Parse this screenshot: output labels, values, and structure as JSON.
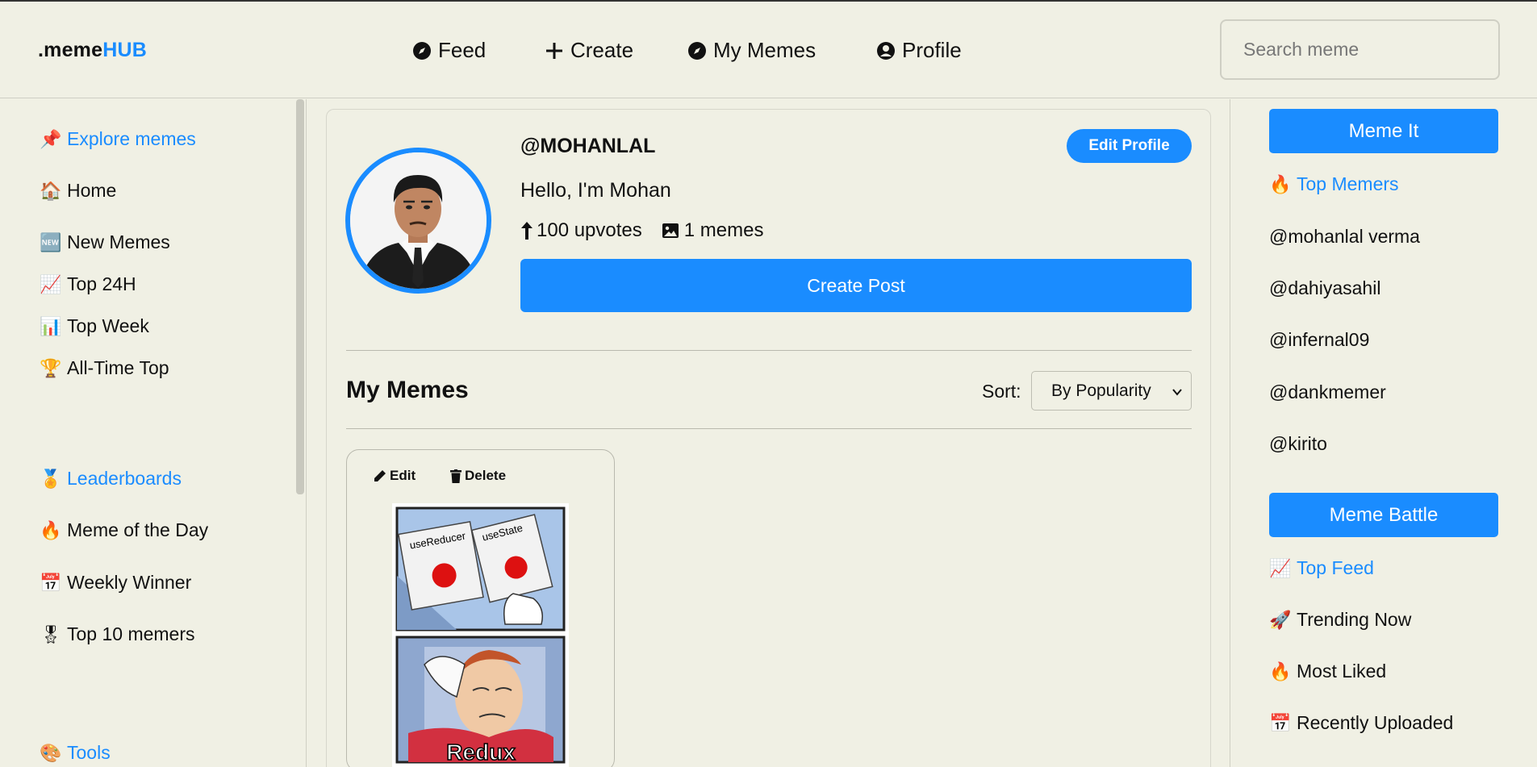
{
  "brand": {
    "prefix": ".meme",
    "suffix": "HUB"
  },
  "nav": [
    {
      "label": "Feed",
      "icon": "compass-icon"
    },
    {
      "label": "Create",
      "icon": "plus-icon"
    },
    {
      "label": "My Memes",
      "icon": "compass-icon"
    },
    {
      "label": "Profile",
      "icon": "user-circle-icon"
    }
  ],
  "search": {
    "placeholder": "Search meme"
  },
  "left_sidebar": {
    "items": [
      {
        "label": "Explore memes",
        "icon": "📌"
      },
      {
        "label": "Home",
        "icon": "🏠"
      },
      {
        "label": "New Memes",
        "icon": "🆕"
      },
      {
        "label": "Top 24H",
        "icon": "📈"
      },
      {
        "label": "Top Week",
        "icon": "📊"
      },
      {
        "label": "All-Time Top",
        "icon": "🏆"
      },
      {
        "label": "Leaderboards",
        "icon": "🏅"
      },
      {
        "label": "Meme of the Day",
        "icon": "🔥"
      },
      {
        "label": "Weekly Winner",
        "icon": "📅"
      },
      {
        "label": "Top 10 memers",
        "icon": "🎖"
      },
      {
        "label": "Tools",
        "icon": "🎨"
      }
    ]
  },
  "profile": {
    "username": "@MOHANLAL",
    "bio": "Hello, I'm Mohan",
    "upvotes": "100 upvotes",
    "memes": "1 memes",
    "edit_label": "Edit Profile",
    "create_label": "Create Post"
  },
  "my_memes": {
    "title": "My Memes",
    "sort_label": "Sort:",
    "sort_value": "By Popularity",
    "card": {
      "edit_label": "Edit",
      "delete_label": "Delete",
      "panel_top_left": "useReducer",
      "panel_top_right": "useState",
      "panel_bottom_caption": "Redux"
    }
  },
  "right_sidebar": {
    "meme_it_label": "Meme It",
    "top_memers_label": "Top Memers",
    "top_memers_icon": "🔥",
    "memers": [
      "@mohanlal verma",
      "@dahiyasahil",
      "@infernal09",
      "@dankmemer",
      "@kirito"
    ],
    "meme_battle_label": "Meme Battle",
    "feed_items": [
      {
        "label": "Top Feed",
        "icon": "📈"
      },
      {
        "label": "Trending Now",
        "icon": "🚀"
      },
      {
        "label": "Most Liked",
        "icon": "🔥"
      },
      {
        "label": "Recently Uploaded",
        "icon": "📅"
      }
    ]
  },
  "colors": {
    "accent": "#1a8cff",
    "background": "#f0f0e4"
  }
}
